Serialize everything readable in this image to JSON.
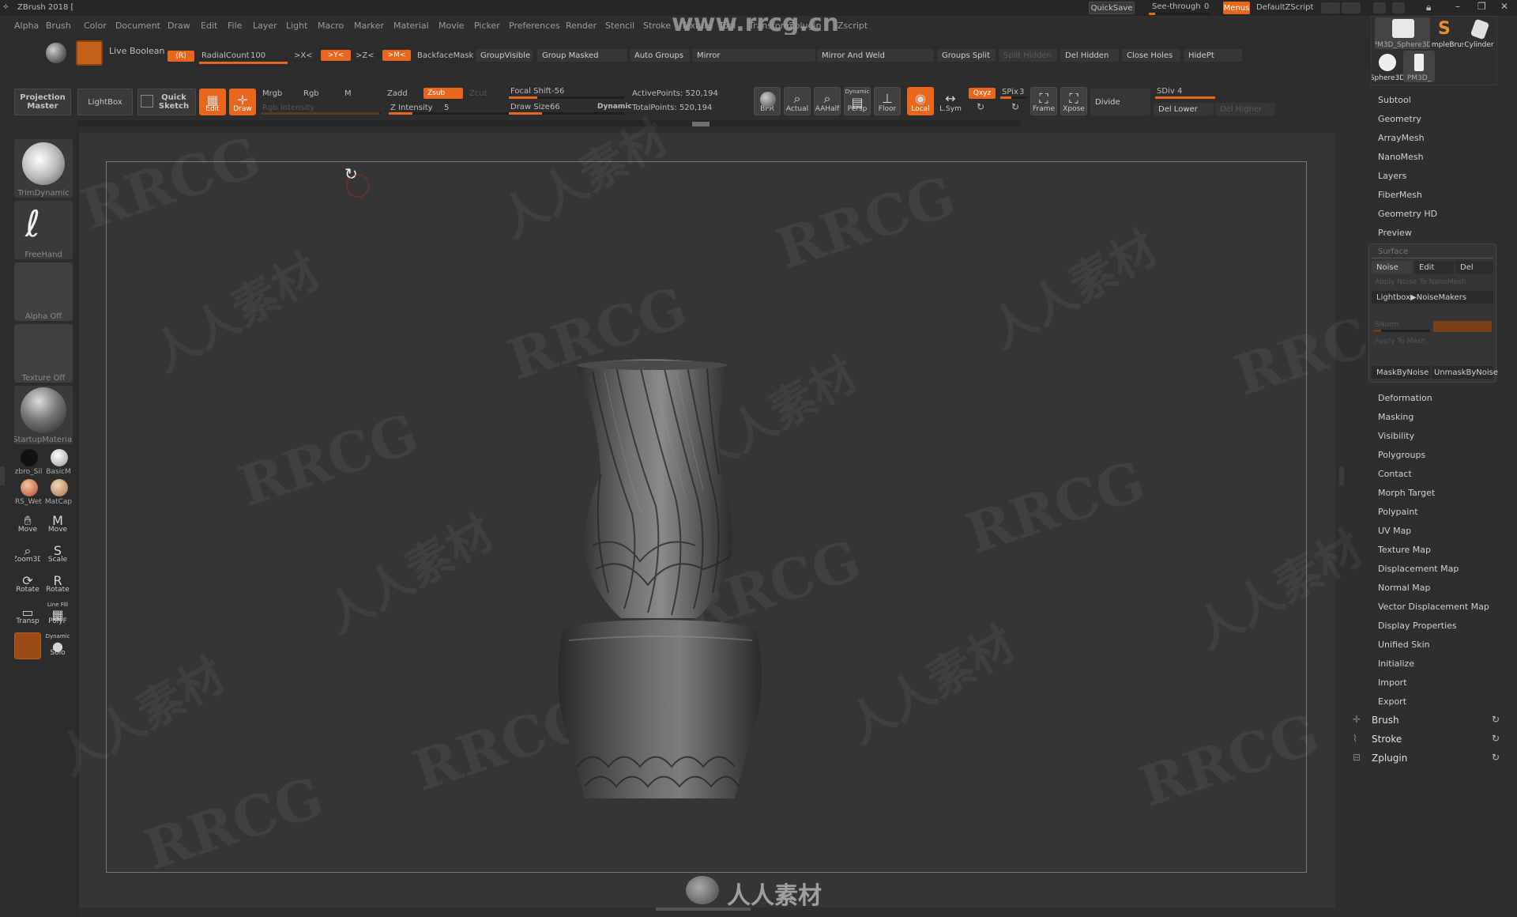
{
  "app": {
    "title": "ZBrush 2018 [",
    "site_watermark": "www.rrcg.cn",
    "bottom_logo_text": "人人素材"
  },
  "menubar": {
    "items": [
      "Alpha",
      "Brush",
      "Color",
      "Document",
      "Draw",
      "Edit",
      "File",
      "Layer",
      "Light",
      "Macro",
      "Marker",
      "Material",
      "Movie",
      "Picker",
      "Preferences",
      "Render",
      "Stencil",
      "Stroke",
      "Texture",
      "Tool",
      "Transform",
      "Zplugin",
      "Zscript"
    ],
    "quicksave": "QuickSave",
    "see_through_label": "See-through",
    "see_through_value": "0",
    "menus": "Menus",
    "default_zscript": "DefaultZScript"
  },
  "top_bar": {
    "live_boolean": "Live Boolean",
    "r_label": "(R)",
    "radial_count_label": "RadialCount",
    "radial_count_value": "100",
    "x_sym": ">X<",
    "y_sym": ">Y<",
    "z_sym": ">Z<",
    "m_sym": ">M<",
    "backface_mask": "BackfaceMask",
    "group_visible": "GroupVisible",
    "group_masked": "Group Masked",
    "auto_groups": "Auto Groups",
    "mirror": "Mirror",
    "mirror_and_weld": "Mirror And Weld",
    "groups_split": "Groups Split",
    "split_hidden": "Split Hidden",
    "del_hidden": "Del Hidden",
    "close_holes": "Close Holes",
    "hide_pt": "HidePt"
  },
  "toolbar": {
    "projection_master": "Projection Master",
    "lightbox": "LightBox",
    "quick_sketch": "Quick Sketch",
    "edit": "Edit",
    "draw": "Draw",
    "mrgb": "Mrgb",
    "rgb": "Rgb",
    "m": "M",
    "zadd": "Zadd",
    "zsub": "Zsub",
    "zcut": "Zcut",
    "rgb_intensity": "Rgb Intensity",
    "z_intensity_label": "Z Intensity",
    "z_intensity_value": "5",
    "focal_shift_label": "Focal Shift",
    "focal_shift_value": "-56",
    "draw_size_label": "Draw Size",
    "draw_size_value": "66",
    "dynamic": "Dynamic",
    "active_points": "ActivePoints: 520,194",
    "total_points": "TotalPoints: 520,194",
    "bpr": "BPR",
    "actual": "Actual",
    "aahalf": "AAHalf",
    "dynamic_persp": "Dynamic",
    "persp": "Persp",
    "floor": "Floor",
    "local": "Local",
    "lsym": "L.Sym",
    "xyz": "Qxyz",
    "spix_label": "SPix",
    "spix_value": "3",
    "frame": "Frame",
    "xpose": "Xpose",
    "divide": "Divide",
    "sdiv_label": "SDiv",
    "sdiv_value": "4",
    "del_lower": "Del Lower",
    "del_higher": "Del Higher"
  },
  "left_shelf": {
    "brush": "TrimDynamic",
    "stroke": "FreeHand",
    "alpha": "Alpha Off",
    "texture": "Texture Off",
    "material": "StartupMaterial",
    "mat_a": "zbro_Sil",
    "mat_b": "BasicM",
    "mat_c": "RS_Wet",
    "mat_d": "MatCap",
    "move3d": "Move",
    "move": "Move",
    "zoom3d": "Zoom3D",
    "scale": "Scale",
    "rotate3d": "Rotate",
    "rotate": "Rotate",
    "transp": "Transp",
    "polyf": "PolyF",
    "line_fill": "Line Fill",
    "dynamic": "Dynamic",
    "solo": "Solo"
  },
  "tool_thumbs": [
    "PM3D_Sphere3D",
    "SimpleBrush",
    "Cylinder",
    "Sphere3D",
    "PM3D_"
  ],
  "right_menu": {
    "top_items": [
      "Subtool",
      "Geometry",
      "ArrayMesh",
      "NanoMesh",
      "Layers",
      "FiberMesh",
      "Geometry HD",
      "Preview"
    ],
    "surface": {
      "header": "Surface",
      "noise": "Noise",
      "edit": "Edit",
      "del": "Del",
      "apply_noise": "Apply Noise To NanoMesh",
      "lightbox_noisemakers": "Lightbox▶NoiseMakers",
      "snorm": "SNorm",
      "apply_to_mesh": "Apply To Mesh",
      "mask_by_noise": "MaskByNoise",
      "unmask_by_noise": "UnmaskByNoise"
    },
    "bottom_items": [
      "Deformation",
      "Masking",
      "Visibility",
      "Polygroups",
      "Contact",
      "Morph Target",
      "Polypaint",
      "UV Map",
      "Texture Map",
      "Displacement Map",
      "Normal Map",
      "Vector Displacement Map",
      "Display Properties",
      "Unified Skin",
      "Initialize",
      "Import",
      "Export"
    ],
    "palettes": [
      "Brush",
      "Stroke",
      "Zplugin"
    ]
  },
  "colors": {
    "accent": "#e8671d",
    "bg": "#2e2e2e",
    "canvas": "#353535"
  }
}
